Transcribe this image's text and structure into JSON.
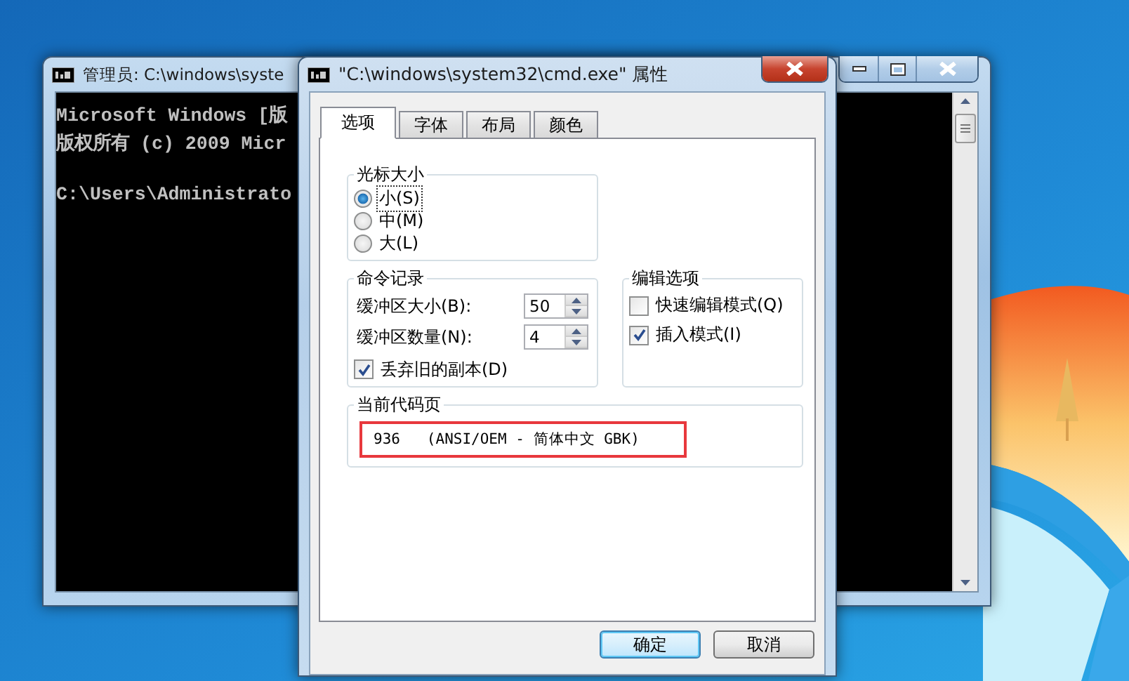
{
  "console_window": {
    "title": "管理员: C:\\windows\\syste",
    "header_lines": [
      "Microsoft Windows [版",
      "版权所有 (c) 2009 Micr"
    ],
    "prompt": "C:\\Users\\Administrato"
  },
  "dialog": {
    "title": "\"C:\\windows\\system32\\cmd.exe\" 属性",
    "tabs": [
      {
        "label": "选项",
        "selected": true
      },
      {
        "label": "字体",
        "selected": false
      },
      {
        "label": "布局",
        "selected": false
      },
      {
        "label": "颜色",
        "selected": false
      }
    ],
    "cursor_size": {
      "title": "光标大小",
      "options": [
        {
          "label": "小(S)",
          "selected": true,
          "focused": true
        },
        {
          "label": "中(M)",
          "selected": false,
          "focused": false
        },
        {
          "label": "大(L)",
          "selected": false,
          "focused": false
        }
      ]
    },
    "command_history": {
      "title": "命令记录",
      "fields": [
        {
          "label": "缓冲区大小(B):",
          "value": "50"
        },
        {
          "label": "缓冲区数量(N):",
          "value": "4"
        }
      ],
      "discard_old": {
        "label": "丢弃旧的副本(D)",
        "checked": true
      }
    },
    "edit_options": {
      "title": "编辑选项",
      "items": [
        {
          "label": "快速编辑模式(Q)",
          "checked": false
        },
        {
          "label": "插入模式(I)",
          "checked": true
        }
      ]
    },
    "code_page": {
      "title": "当前代码页",
      "value": "936   (ANSI/OEM - 简体中文 GBK)",
      "highlighted": true
    },
    "buttons": [
      {
        "label": "确定",
        "default": true
      },
      {
        "label": "取消",
        "default": false
      }
    ]
  }
}
